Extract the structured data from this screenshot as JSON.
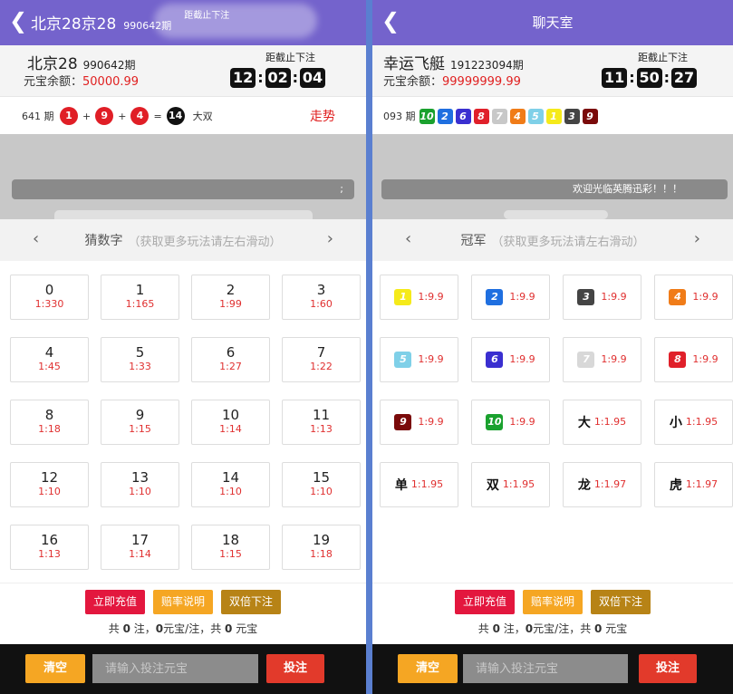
{
  "left": {
    "topbar": {
      "glitch_title": "北京28京28",
      "glitch_period": "990642期",
      "glitch_right": "距截止下注"
    },
    "info": {
      "game_name": "北京28",
      "period": "990642期",
      "balance_label": "元宝余额：",
      "balance_value": "50000.99",
      "countdown_label": "距截止下注",
      "countdown": [
        "12",
        "02",
        "04"
      ]
    },
    "result": {
      "period": "641 期",
      "balls": [
        "1",
        "9",
        "4"
      ],
      "sum": "14",
      "result_text": "大双",
      "trend_label": "走势"
    },
    "tab": {
      "title": "猜数字",
      "hint": "（获取更多玩法请左右滑动）"
    },
    "cells": [
      {
        "n": "0",
        "o": "1:330"
      },
      {
        "n": "1",
        "o": "1:165"
      },
      {
        "n": "2",
        "o": "1:99"
      },
      {
        "n": "3",
        "o": "1:60"
      },
      {
        "n": "4",
        "o": "1:45"
      },
      {
        "n": "5",
        "o": "1:33"
      },
      {
        "n": "6",
        "o": "1:27"
      },
      {
        "n": "7",
        "o": "1:22"
      },
      {
        "n": "8",
        "o": "1:18"
      },
      {
        "n": "9",
        "o": "1:15"
      },
      {
        "n": "10",
        "o": "1:14"
      },
      {
        "n": "11",
        "o": "1:13"
      },
      {
        "n": "12",
        "o": "1:10"
      },
      {
        "n": "13",
        "o": "1:10"
      },
      {
        "n": "14",
        "o": "1:10"
      },
      {
        "n": "15",
        "o": "1:10"
      },
      {
        "n": "16",
        "o": "1:13"
      },
      {
        "n": "17",
        "o": "1:14"
      },
      {
        "n": "18",
        "o": "1:15"
      },
      {
        "n": "19",
        "o": "1:18"
      }
    ]
  },
  "right": {
    "topbar": {
      "title": "聊天室"
    },
    "info": {
      "game_name": "幸运飞艇",
      "period": "191223094期",
      "balance_label": "元宝余额：",
      "balance_value": "99999999.99",
      "countdown_label": "距截止下注",
      "countdown": [
        "11",
        "50",
        "27"
      ]
    },
    "result": {
      "period": "093 期",
      "squares": [
        {
          "v": "10",
          "c": "#1aa12e"
        },
        {
          "v": "2",
          "c": "#1f6fe0"
        },
        {
          "v": "6",
          "c": "#3a2fd0"
        },
        {
          "v": "8",
          "c": "#e0202a"
        },
        {
          "v": "7",
          "c": "#c8c8c8"
        },
        {
          "v": "4",
          "c": "#f07c18"
        },
        {
          "v": "5",
          "c": "#7fd0e8"
        },
        {
          "v": "1",
          "c": "#f5ea1a"
        },
        {
          "v": "3",
          "c": "#444444"
        },
        {
          "v": "9",
          "c": "#7a0a0a"
        }
      ]
    },
    "notice": "欢迎光临英腾迅彩！！！",
    "tab": {
      "title": "冠军",
      "hint": "（获取更多玩法请左右滑动）"
    },
    "cells": [
      {
        "v": "1",
        "c": "#f5ea1a",
        "o": "1:9.9"
      },
      {
        "v": "2",
        "c": "#1f6fe0",
        "o": "1:9.9"
      },
      {
        "v": "3",
        "c": "#444444",
        "o": "1:9.9"
      },
      {
        "v": "4",
        "c": "#f07c18",
        "o": "1:9.9"
      },
      {
        "v": "5",
        "c": "#7fd0e8",
        "o": "1:9.9"
      },
      {
        "v": "6",
        "c": "#3a2fd0",
        "o": "1:9.9"
      },
      {
        "v": "7",
        "c": "#d8d8d8",
        "o": "1:9.9"
      },
      {
        "v": "8",
        "c": "#e0202a",
        "o": "1:9.9"
      },
      {
        "v": "9",
        "c": "#7a0a0a",
        "o": "1:9.9"
      },
      {
        "v": "10",
        "c": "#1aa12e",
        "o": "1:9.9"
      },
      {
        "t": "大",
        "o": "1:1.95"
      },
      {
        "t": "小",
        "o": "1:1.95"
      },
      {
        "t": "单",
        "o": "1:1.95"
      },
      {
        "t": "双",
        "o": "1:1.95"
      },
      {
        "t": "龙",
        "o": "1:1.97"
      },
      {
        "t": "虎",
        "o": "1:1.97"
      }
    ]
  },
  "actions": {
    "recharge": "立即充值",
    "odds": "赔率说明",
    "double": "双倍下注",
    "sum_prefix": "共",
    "sum_bets": "0",
    "sum_mid1": "注，",
    "sum_per": "0",
    "sum_mid2": "元宝/注，共",
    "sum_total": "0",
    "sum_suffix": "元宝"
  },
  "bottom": {
    "clear": "清空",
    "placeholder": "请输入投注元宝",
    "submit": "投注"
  }
}
